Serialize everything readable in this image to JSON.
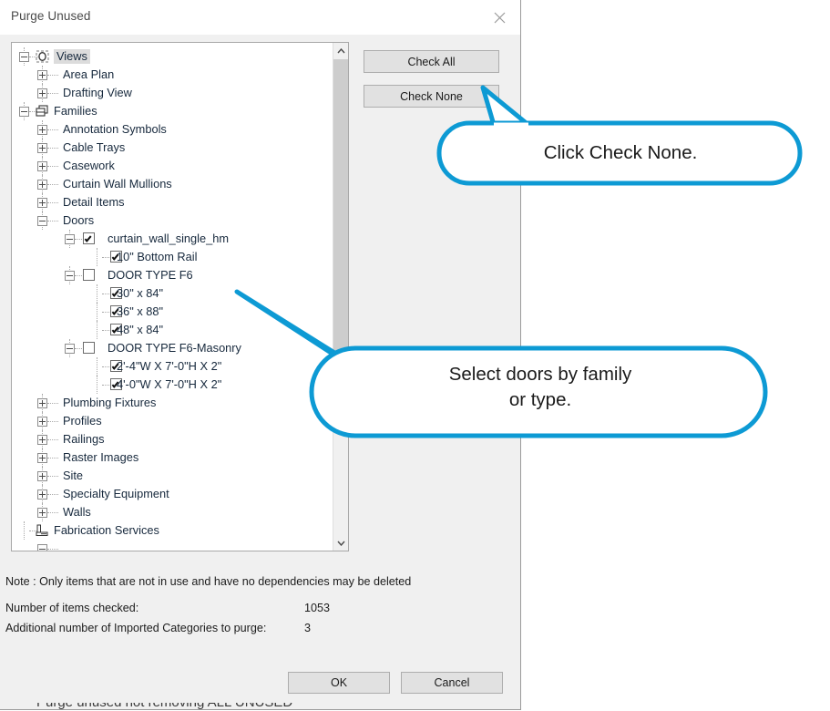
{
  "dialog": {
    "title": "Purge Unused",
    "close_icon": "close-icon"
  },
  "tree": {
    "rows": [
      {
        "label": "Views",
        "indent": 0,
        "type": "node",
        "expander": "minus",
        "icon": "views-icon",
        "selected": true
      },
      {
        "label": "Area Plan",
        "indent": 1,
        "type": "node",
        "expander": "plus",
        "icon": null,
        "selected": false
      },
      {
        "label": "Drafting View",
        "indent": 1,
        "type": "node",
        "expander": "plus",
        "icon": null,
        "selected": false
      },
      {
        "label": "Families",
        "indent": 0,
        "type": "node",
        "expander": "minus",
        "icon": "families-icon",
        "selected": false
      },
      {
        "label": "Annotation Symbols",
        "indent": 1,
        "type": "node",
        "expander": "plus",
        "icon": null,
        "selected": false
      },
      {
        "label": "Cable Trays",
        "indent": 1,
        "type": "node",
        "expander": "plus",
        "icon": null,
        "selected": false
      },
      {
        "label": "Casework",
        "indent": 1,
        "type": "node",
        "expander": "plus",
        "icon": null,
        "selected": false
      },
      {
        "label": "Curtain Wall Mullions",
        "indent": 1,
        "type": "node",
        "expander": "plus",
        "icon": null,
        "selected": false
      },
      {
        "label": "Detail Items",
        "indent": 1,
        "type": "node",
        "expander": "plus",
        "icon": null,
        "selected": false
      },
      {
        "label": "Doors",
        "indent": 1,
        "type": "node",
        "expander": "minus",
        "icon": null,
        "selected": false
      },
      {
        "label": "curtain_wall_single_hm",
        "indent": 2,
        "type": "checkbox",
        "expander": "minus",
        "checked": true
      },
      {
        "label": "10\" Bottom Rail",
        "indent": 3,
        "type": "checkbox",
        "expander": null,
        "checked": true
      },
      {
        "label": "DOOR TYPE F6",
        "indent": 2,
        "type": "checkbox",
        "expander": "minus",
        "checked": false
      },
      {
        "label": "30\" x 84\"",
        "indent": 3,
        "type": "checkbox",
        "expander": null,
        "checked": true
      },
      {
        "label": "36\" x 88\"",
        "indent": 3,
        "type": "checkbox",
        "expander": null,
        "checked": true
      },
      {
        "label": "48\" x 84\"",
        "indent": 3,
        "type": "checkbox",
        "expander": null,
        "checked": true
      },
      {
        "label": "DOOR TYPE F6-Masonry",
        "indent": 2,
        "type": "checkbox",
        "expander": "minus",
        "checked": false
      },
      {
        "label": "2'-4\"W X 7'-0\"H X 2\"",
        "indent": 3,
        "type": "checkbox",
        "expander": null,
        "checked": true
      },
      {
        "label": "4'-0\"W X 7'-0\"H X 2\"",
        "indent": 3,
        "type": "checkbox",
        "expander": null,
        "checked": true
      },
      {
        "label": "Plumbing Fixtures",
        "indent": 1,
        "type": "node",
        "expander": "plus",
        "icon": null,
        "selected": false
      },
      {
        "label": "Profiles",
        "indent": 1,
        "type": "node",
        "expander": "plus",
        "icon": null,
        "selected": false
      },
      {
        "label": "Railings",
        "indent": 1,
        "type": "node",
        "expander": "plus",
        "icon": null,
        "selected": false
      },
      {
        "label": "Raster Images",
        "indent": 1,
        "type": "node",
        "expander": "plus",
        "icon": null,
        "selected": false
      },
      {
        "label": "Site",
        "indent": 1,
        "type": "node",
        "expander": "plus",
        "icon": null,
        "selected": false
      },
      {
        "label": "Specialty Equipment",
        "indent": 1,
        "type": "node",
        "expander": "plus",
        "icon": null,
        "selected": false
      },
      {
        "label": "Walls",
        "indent": 1,
        "type": "node",
        "expander": "plus",
        "icon": null,
        "selected": false
      },
      {
        "label": "Fabrication Services",
        "indent": 0,
        "type": "node",
        "expander": null,
        "icon": "fabrication-icon",
        "selected": false
      }
    ],
    "scrollbar": {
      "up_icon": "chevron-up-icon",
      "down_icon": "chevron-down-icon"
    }
  },
  "buttons": {
    "check_all": "Check All",
    "check_none": "Check None",
    "ok": "OK",
    "cancel": "Cancel"
  },
  "footer": {
    "note": "Note : Only items that are not in use and have no dependencies may be deleted",
    "items_checked_label": "Number of items checked:",
    "items_checked_value": "1053",
    "imported_label": "Additional number of Imported Categories to purge:",
    "imported_value": "3",
    "cut_off_text": "Purge unused not removing ALL UNUSED"
  },
  "callouts": [
    {
      "text": "Click Check None.",
      "color": "#0d9ad4"
    },
    {
      "text_line1": "Select doors by family",
      "text_line2": "or type.",
      "color": "#0d9ad4"
    }
  ],
  "colors": {
    "accent": "#0d9ad4",
    "dialog_bg": "#f0f0f0",
    "tree_bg": "#ffffff",
    "button_bg": "#e1e1e1",
    "text": "#16283c"
  }
}
